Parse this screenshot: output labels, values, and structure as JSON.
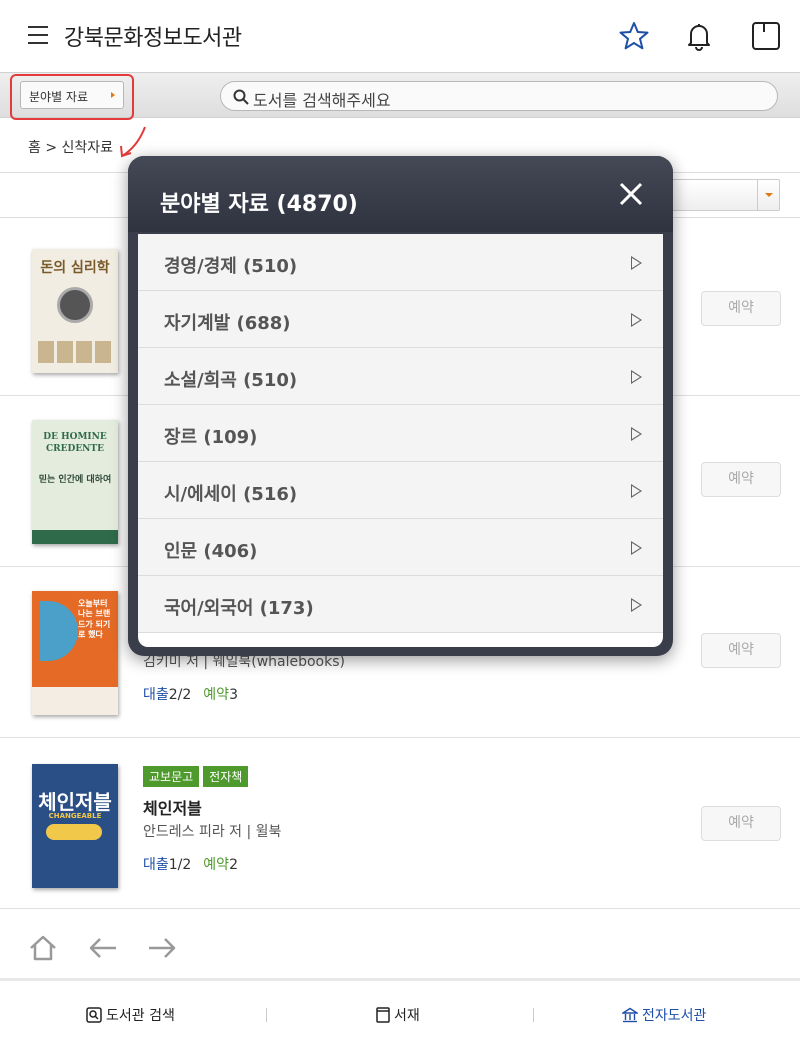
{
  "header": {
    "title": "강북문화정보도서관"
  },
  "search": {
    "category_label": "분야별 자료",
    "placeholder": "도서를 검색해주세요"
  },
  "breadcrumb": "홈 > 신착자료",
  "books": [
    {
      "cover_title": "돈의 심리학",
      "cover_sub": "",
      "reserve": "예약"
    },
    {
      "cover_title": "DE HOMINE CREDENTE",
      "cover_sub": "믿는 인간에 대하여",
      "reserve": "예약"
    },
    {
      "cover_title": "오늘부터 나는 브랜드가 되기로 했다",
      "meta": "김키미 저 | 웨일북(whalebooks)",
      "loan_label": "대출",
      "loan_value": "2/2",
      "reserve_label": "예약",
      "reserve_value": "3",
      "reserve": "예약"
    },
    {
      "cover_title": "체인저블",
      "cover_sub": "CHANGEABLE",
      "tags": [
        "교보문고",
        "전자책"
      ],
      "title": "체인저블",
      "meta": "안드레스 피라 저 | 윌북",
      "loan_label": "대출",
      "loan_value": "1/2",
      "reserve_label": "예약",
      "reserve_value": "2",
      "reserve": "예약"
    }
  ],
  "modal": {
    "title": "분야별 자료 (4870)",
    "items": [
      {
        "label": "경영/경제 (510)"
      },
      {
        "label": "자기계발 (688)"
      },
      {
        "label": "소설/희곡 (510)"
      },
      {
        "label": "장르 (109)"
      },
      {
        "label": "시/에세이 (516)"
      },
      {
        "label": "인문 (406)"
      },
      {
        "label": "국어/외국어 (173)"
      }
    ]
  },
  "tabs": [
    {
      "label": "도서관 검색",
      "icon": "search-icon"
    },
    {
      "label": "서재",
      "icon": "book-icon"
    },
    {
      "label": "전자도서관",
      "icon": "library-icon"
    }
  ],
  "colors": {
    "accent": "#1e4fa8",
    "green": "#4f9a2c",
    "annotation_red": "#e33b3b",
    "modal_dark": "#3a3e4a"
  }
}
